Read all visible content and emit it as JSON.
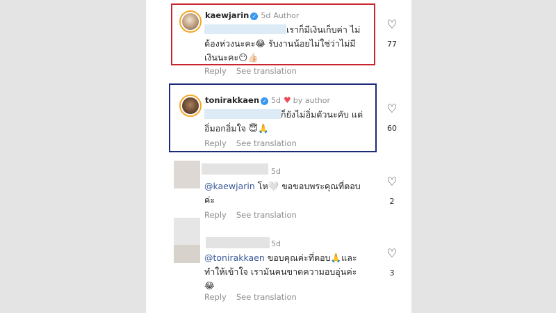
{
  "comments": [
    {
      "username": "kaewjarin",
      "time": "5d",
      "badge": "Author",
      "text_line1": "เราก็มีเงินเก็บค่า ไม่",
      "text_line2": "ต้องห่วงนะคะ😂 รับงานน้อยไม่ใช่ว่าไม่มี",
      "text_line3": "เงินนะคะ😶👍🏻",
      "reply": "Reply",
      "translate": "See translation",
      "likes": "77"
    },
    {
      "username": "tonirakkaen",
      "time": "5d",
      "badge": "by author",
      "text_line1": "ก็ยังไม่อิ่มตัวนะคับ แต่",
      "text_line2": "อิ่มอกอิ่มใจ 😇🙏",
      "reply": "Reply",
      "translate": "See translation",
      "likes": "60"
    },
    {
      "time": "5d",
      "mention": "@kaewjarin",
      "text_line1": " โห🤍 ขอขอบพระคุณที่ตอบ",
      "text_line2": "ค่ะ",
      "reply": "Reply",
      "translate": "See translation",
      "likes": "2"
    },
    {
      "time": "5d",
      "mention": "@tonirakkaen",
      "text_line1": " ขอบคุณค่ะที่ตอบ🙏และ",
      "text_line2": "ทำให้เข้าใจ เรามันคนขาดความอบอุ่นค่ะ",
      "text_line3": "😂",
      "reply": "Reply",
      "translate": "See translation",
      "likes": "3"
    }
  ],
  "colors": {
    "highlight_red": "#c8262c",
    "highlight_blue": "#1c2a7a",
    "verified": "#3897f0",
    "mention": "#385898"
  },
  "icons": [
    "heart-outline-icon",
    "verified-badge-icon",
    "red-heart-icon"
  ]
}
